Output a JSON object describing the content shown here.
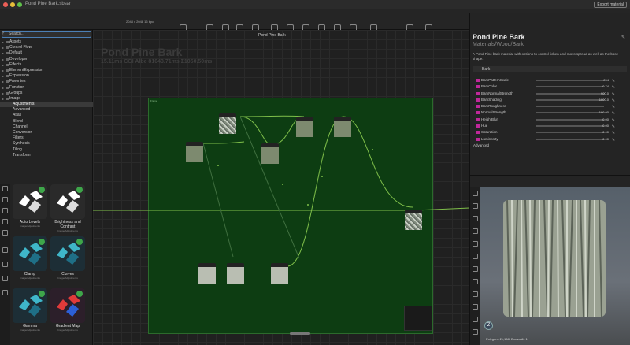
{
  "window": {
    "title": "Pond Pine Bark.sbsar",
    "right_button": "Export material"
  },
  "toolbar": {
    "resolution": "2048 x 2048  16 bpc"
  },
  "search": {
    "placeholder": "Search..."
  },
  "tree": [
    {
      "label": "Assets",
      "kind": "top"
    },
    {
      "label": "Control Flow",
      "kind": "top"
    },
    {
      "label": "Default",
      "kind": "top"
    },
    {
      "label": "Developer",
      "kind": "top"
    },
    {
      "label": "Effects",
      "kind": "top"
    },
    {
      "label": "ElementExpression",
      "kind": "top"
    },
    {
      "label": "Expression",
      "kind": "top"
    },
    {
      "label": "Favorites",
      "kind": "top"
    },
    {
      "label": "Function",
      "kind": "top"
    },
    {
      "label": "Groups",
      "kind": "top"
    },
    {
      "label": "Image",
      "kind": "top"
    },
    {
      "label": "Adjustments",
      "kind": "child",
      "selected": true
    },
    {
      "label": "Advanced",
      "kind": "child"
    },
    {
      "label": "Atlas",
      "kind": "child"
    },
    {
      "label": "Blend",
      "kind": "child"
    },
    {
      "label": "Channel",
      "kind": "child"
    },
    {
      "label": "Conversion",
      "kind": "child"
    },
    {
      "label": "Filters",
      "kind": "child"
    },
    {
      "label": "Synthesis",
      "kind": "child"
    },
    {
      "label": "Tiling",
      "kind": "child"
    },
    {
      "label": "Transform",
      "kind": "child"
    }
  ],
  "library": [
    {
      "label": "Auto Levels",
      "sub": "Image/Adjustments",
      "icon": "white"
    },
    {
      "label": "Brightness and Contrast",
      "sub": "Image/Adjustments",
      "icon": "white"
    },
    {
      "label": "Clamp",
      "sub": "Image/Adjustments",
      "icon": "teal"
    },
    {
      "label": "Curves",
      "sub": "Image/Adjustments",
      "icon": "teal"
    },
    {
      "label": "Gamma",
      "sub": "Image/Adjustments",
      "icon": "teal"
    },
    {
      "label": "Gradient Map",
      "sub": "Image/Adjustments",
      "icon": "rgb"
    }
  ],
  "canvas": {
    "graph_title": "Pond Pine Bark",
    "stats": "15.11ms CGI Albe 81043.71ms Σ1050.50ms",
    "tab_label": "Pond Pine Bark"
  },
  "inspector": {
    "title": "Pond Pine Bark",
    "path": "Materials/Wood/Bark",
    "description": "A Pond Pine bark material with options to control lichen and moss spread as well as the base shape.",
    "section": "Bark",
    "params": [
      {
        "name": "BarkPatternScale",
        "value": "204"
      },
      {
        "name": "BarkColor",
        "value": "0.74"
      },
      {
        "name": "BarkNormalStrength",
        "value": "900.0"
      },
      {
        "name": "BarkShading",
        "value": "1000.0"
      },
      {
        "name": "BarkRoughness",
        "value": ""
      },
      {
        "name": "NormalStrength",
        "value": "100.00"
      },
      {
        "name": "HeightBlur",
        "value": "0.00"
      },
      {
        "name": "Hue",
        "value": "0.00"
      },
      {
        "name": "Saturation",
        "value": "0.00"
      },
      {
        "name": "Luminosity",
        "value": "0.00"
      }
    ],
    "more_label": "Advanced"
  },
  "viewport": {
    "badge": "Z",
    "stats": "Polygons 21,168, Drawcalls 1"
  },
  "colors": {
    "frame": "#0d3d12",
    "wire": "#7fbf4a",
    "accent": "#4b7fb5"
  }
}
